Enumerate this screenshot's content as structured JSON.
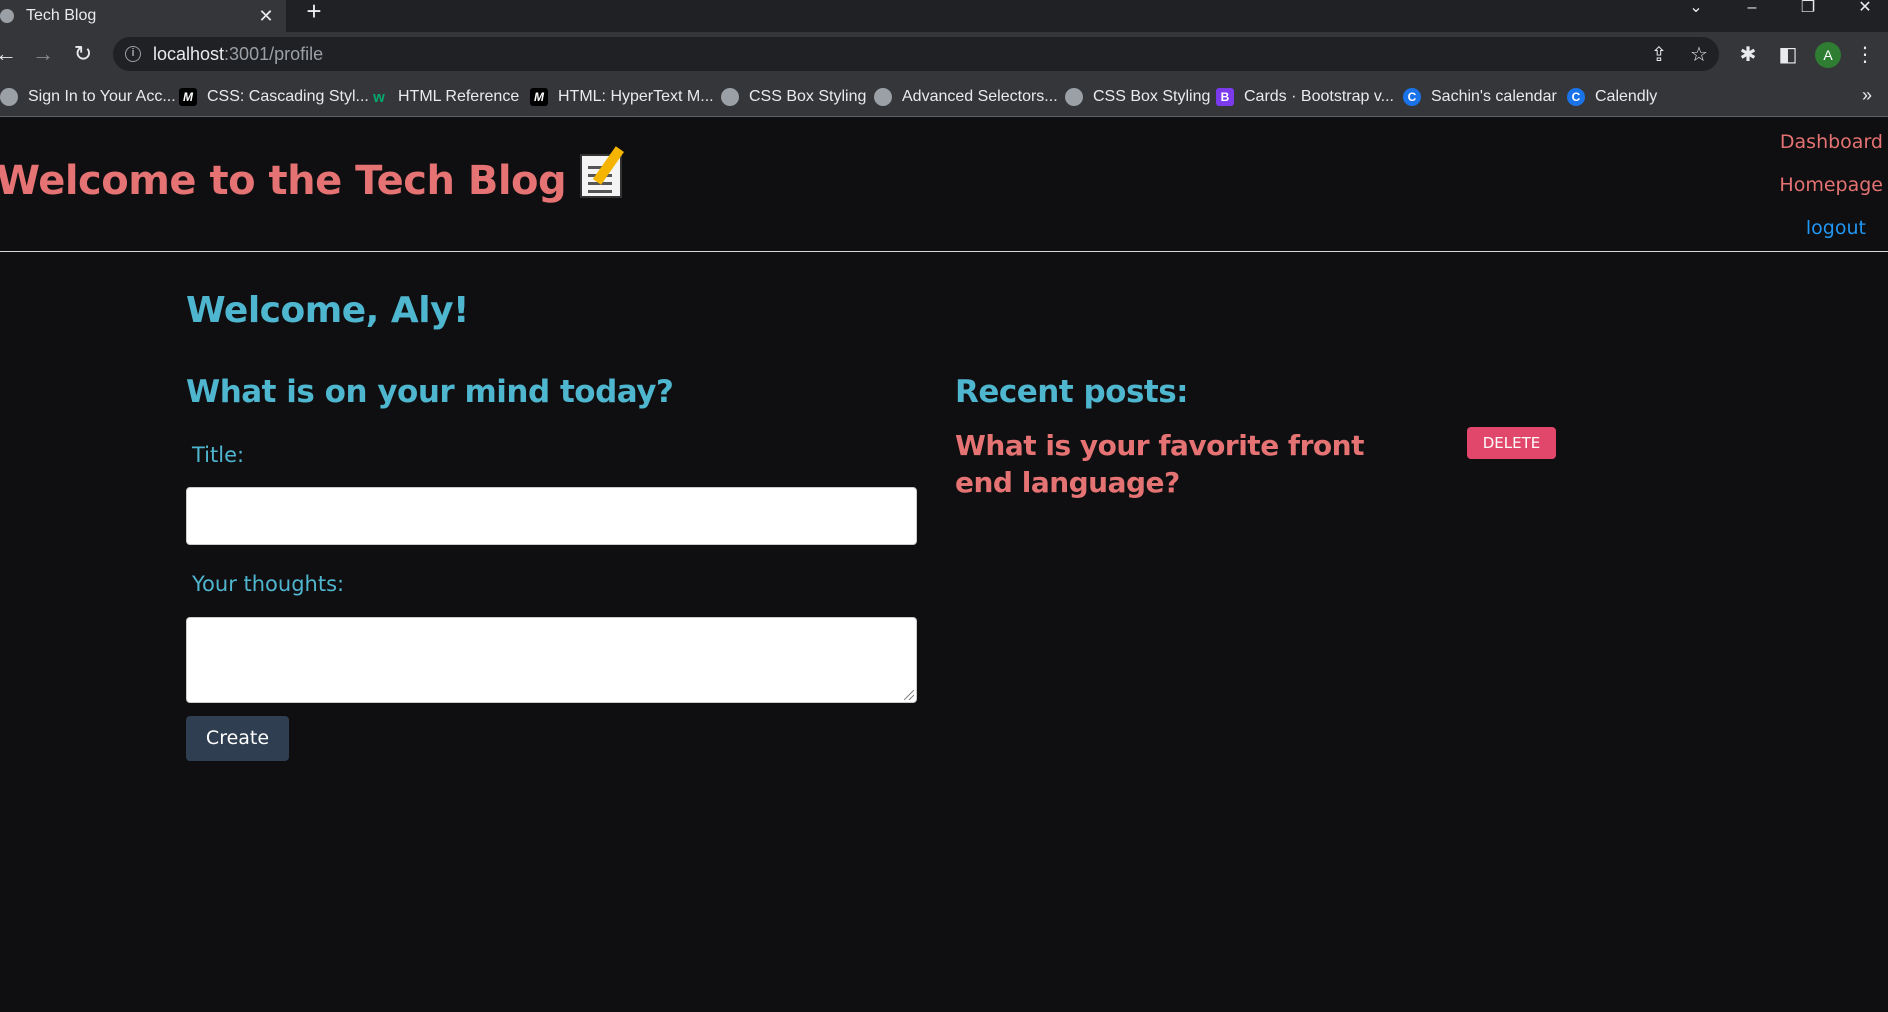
{
  "browser": {
    "tab_title": "Tech Blog",
    "url_host": "localhost",
    "url_path": ":3001/profile",
    "profile_initial": "A",
    "bookmarks": [
      {
        "label": "Sign In to Your Acc...",
        "icon": "globe-icon"
      },
      {
        "label": "CSS: Cascading Styl...",
        "icon": "mdn-icon"
      },
      {
        "label": "HTML Reference",
        "icon": "w3schools-icon"
      },
      {
        "label": "HTML: HyperText M...",
        "icon": "mdn-icon"
      },
      {
        "label": "CSS Box Styling",
        "icon": "globe-icon"
      },
      {
        "label": "Advanced Selectors...",
        "icon": "globe-icon"
      },
      {
        "label": "CSS Box Styling",
        "icon": "globe-icon"
      },
      {
        "label": "Cards · Bootstrap v...",
        "icon": "bootstrap-icon"
      },
      {
        "label": "Sachin's calendar",
        "icon": "calendly-icon"
      },
      {
        "label": "Calendly",
        "icon": "calendly-icon"
      }
    ],
    "bookmarks_overflow": "»"
  },
  "header": {
    "site_title": "Welcome to the Tech Blog",
    "nav": {
      "dashboard": "Dashboard",
      "homepage": "Homepage",
      "logout": "logout"
    }
  },
  "main": {
    "welcome": "Welcome, Aly!",
    "form": {
      "heading": "What is on your mind today?",
      "title_label": "Title:",
      "title_value": "",
      "thoughts_label": "Your thoughts:",
      "thoughts_value": "",
      "submit_label": "Create"
    },
    "recent": {
      "heading": "Recent posts:",
      "posts": [
        {
          "title": "What is your favorite front end language?",
          "delete_label": "DELETE"
        }
      ]
    }
  },
  "colors": {
    "accent_red": "#e57373",
    "accent_teal": "#4fb6cf",
    "logout_blue": "#2196f3",
    "delete_pink": "#e0476a",
    "button_slate": "#2f3e50",
    "page_bg": "#0f0e10"
  }
}
